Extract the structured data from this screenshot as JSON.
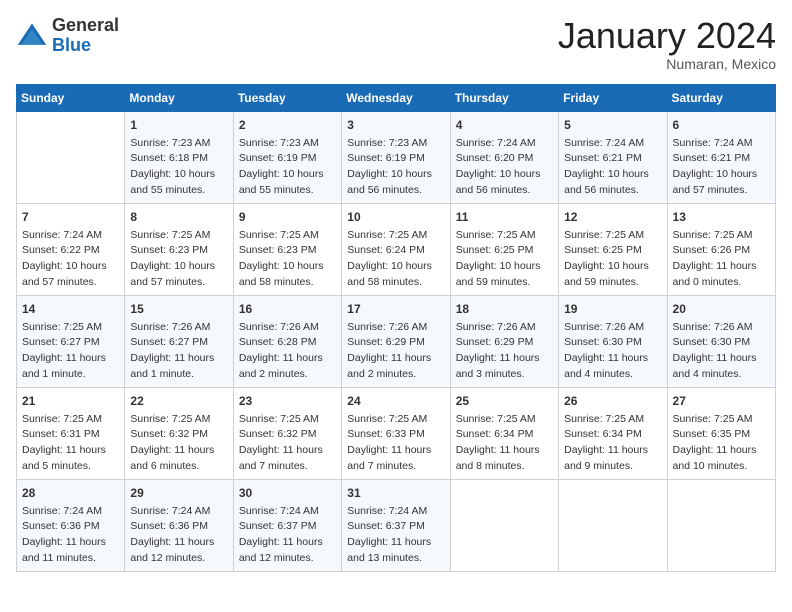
{
  "header": {
    "logo_line1": "General",
    "logo_line2": "Blue",
    "month": "January 2024",
    "location": "Numaran, Mexico"
  },
  "days_of_week": [
    "Sunday",
    "Monday",
    "Tuesday",
    "Wednesday",
    "Thursday",
    "Friday",
    "Saturday"
  ],
  "weeks": [
    [
      {
        "day": "",
        "content": ""
      },
      {
        "day": "1",
        "content": "Sunrise: 7:23 AM\nSunset: 6:18 PM\nDaylight: 10 hours\nand 55 minutes."
      },
      {
        "day": "2",
        "content": "Sunrise: 7:23 AM\nSunset: 6:19 PM\nDaylight: 10 hours\nand 55 minutes."
      },
      {
        "day": "3",
        "content": "Sunrise: 7:23 AM\nSunset: 6:19 PM\nDaylight: 10 hours\nand 56 minutes."
      },
      {
        "day": "4",
        "content": "Sunrise: 7:24 AM\nSunset: 6:20 PM\nDaylight: 10 hours\nand 56 minutes."
      },
      {
        "day": "5",
        "content": "Sunrise: 7:24 AM\nSunset: 6:21 PM\nDaylight: 10 hours\nand 56 minutes."
      },
      {
        "day": "6",
        "content": "Sunrise: 7:24 AM\nSunset: 6:21 PM\nDaylight: 10 hours\nand 57 minutes."
      }
    ],
    [
      {
        "day": "7",
        "content": "Sunrise: 7:24 AM\nSunset: 6:22 PM\nDaylight: 10 hours\nand 57 minutes."
      },
      {
        "day": "8",
        "content": "Sunrise: 7:25 AM\nSunset: 6:23 PM\nDaylight: 10 hours\nand 57 minutes."
      },
      {
        "day": "9",
        "content": "Sunrise: 7:25 AM\nSunset: 6:23 PM\nDaylight: 10 hours\nand 58 minutes."
      },
      {
        "day": "10",
        "content": "Sunrise: 7:25 AM\nSunset: 6:24 PM\nDaylight: 10 hours\nand 58 minutes."
      },
      {
        "day": "11",
        "content": "Sunrise: 7:25 AM\nSunset: 6:25 PM\nDaylight: 10 hours\nand 59 minutes."
      },
      {
        "day": "12",
        "content": "Sunrise: 7:25 AM\nSunset: 6:25 PM\nDaylight: 10 hours\nand 59 minutes."
      },
      {
        "day": "13",
        "content": "Sunrise: 7:25 AM\nSunset: 6:26 PM\nDaylight: 11 hours\nand 0 minutes."
      }
    ],
    [
      {
        "day": "14",
        "content": "Sunrise: 7:25 AM\nSunset: 6:27 PM\nDaylight: 11 hours\nand 1 minute."
      },
      {
        "day": "15",
        "content": "Sunrise: 7:26 AM\nSunset: 6:27 PM\nDaylight: 11 hours\nand 1 minute."
      },
      {
        "day": "16",
        "content": "Sunrise: 7:26 AM\nSunset: 6:28 PM\nDaylight: 11 hours\nand 2 minutes."
      },
      {
        "day": "17",
        "content": "Sunrise: 7:26 AM\nSunset: 6:29 PM\nDaylight: 11 hours\nand 2 minutes."
      },
      {
        "day": "18",
        "content": "Sunrise: 7:26 AM\nSunset: 6:29 PM\nDaylight: 11 hours\nand 3 minutes."
      },
      {
        "day": "19",
        "content": "Sunrise: 7:26 AM\nSunset: 6:30 PM\nDaylight: 11 hours\nand 4 minutes."
      },
      {
        "day": "20",
        "content": "Sunrise: 7:26 AM\nSunset: 6:30 PM\nDaylight: 11 hours\nand 4 minutes."
      }
    ],
    [
      {
        "day": "21",
        "content": "Sunrise: 7:25 AM\nSunset: 6:31 PM\nDaylight: 11 hours\nand 5 minutes."
      },
      {
        "day": "22",
        "content": "Sunrise: 7:25 AM\nSunset: 6:32 PM\nDaylight: 11 hours\nand 6 minutes."
      },
      {
        "day": "23",
        "content": "Sunrise: 7:25 AM\nSunset: 6:32 PM\nDaylight: 11 hours\nand 7 minutes."
      },
      {
        "day": "24",
        "content": "Sunrise: 7:25 AM\nSunset: 6:33 PM\nDaylight: 11 hours\nand 7 minutes."
      },
      {
        "day": "25",
        "content": "Sunrise: 7:25 AM\nSunset: 6:34 PM\nDaylight: 11 hours\nand 8 minutes."
      },
      {
        "day": "26",
        "content": "Sunrise: 7:25 AM\nSunset: 6:34 PM\nDaylight: 11 hours\nand 9 minutes."
      },
      {
        "day": "27",
        "content": "Sunrise: 7:25 AM\nSunset: 6:35 PM\nDaylight: 11 hours\nand 10 minutes."
      }
    ],
    [
      {
        "day": "28",
        "content": "Sunrise: 7:24 AM\nSunset: 6:36 PM\nDaylight: 11 hours\nand 11 minutes."
      },
      {
        "day": "29",
        "content": "Sunrise: 7:24 AM\nSunset: 6:36 PM\nDaylight: 11 hours\nand 12 minutes."
      },
      {
        "day": "30",
        "content": "Sunrise: 7:24 AM\nSunset: 6:37 PM\nDaylight: 11 hours\nand 12 minutes."
      },
      {
        "day": "31",
        "content": "Sunrise: 7:24 AM\nSunset: 6:37 PM\nDaylight: 11 hours\nand 13 minutes."
      },
      {
        "day": "",
        "content": ""
      },
      {
        "day": "",
        "content": ""
      },
      {
        "day": "",
        "content": ""
      }
    ]
  ]
}
